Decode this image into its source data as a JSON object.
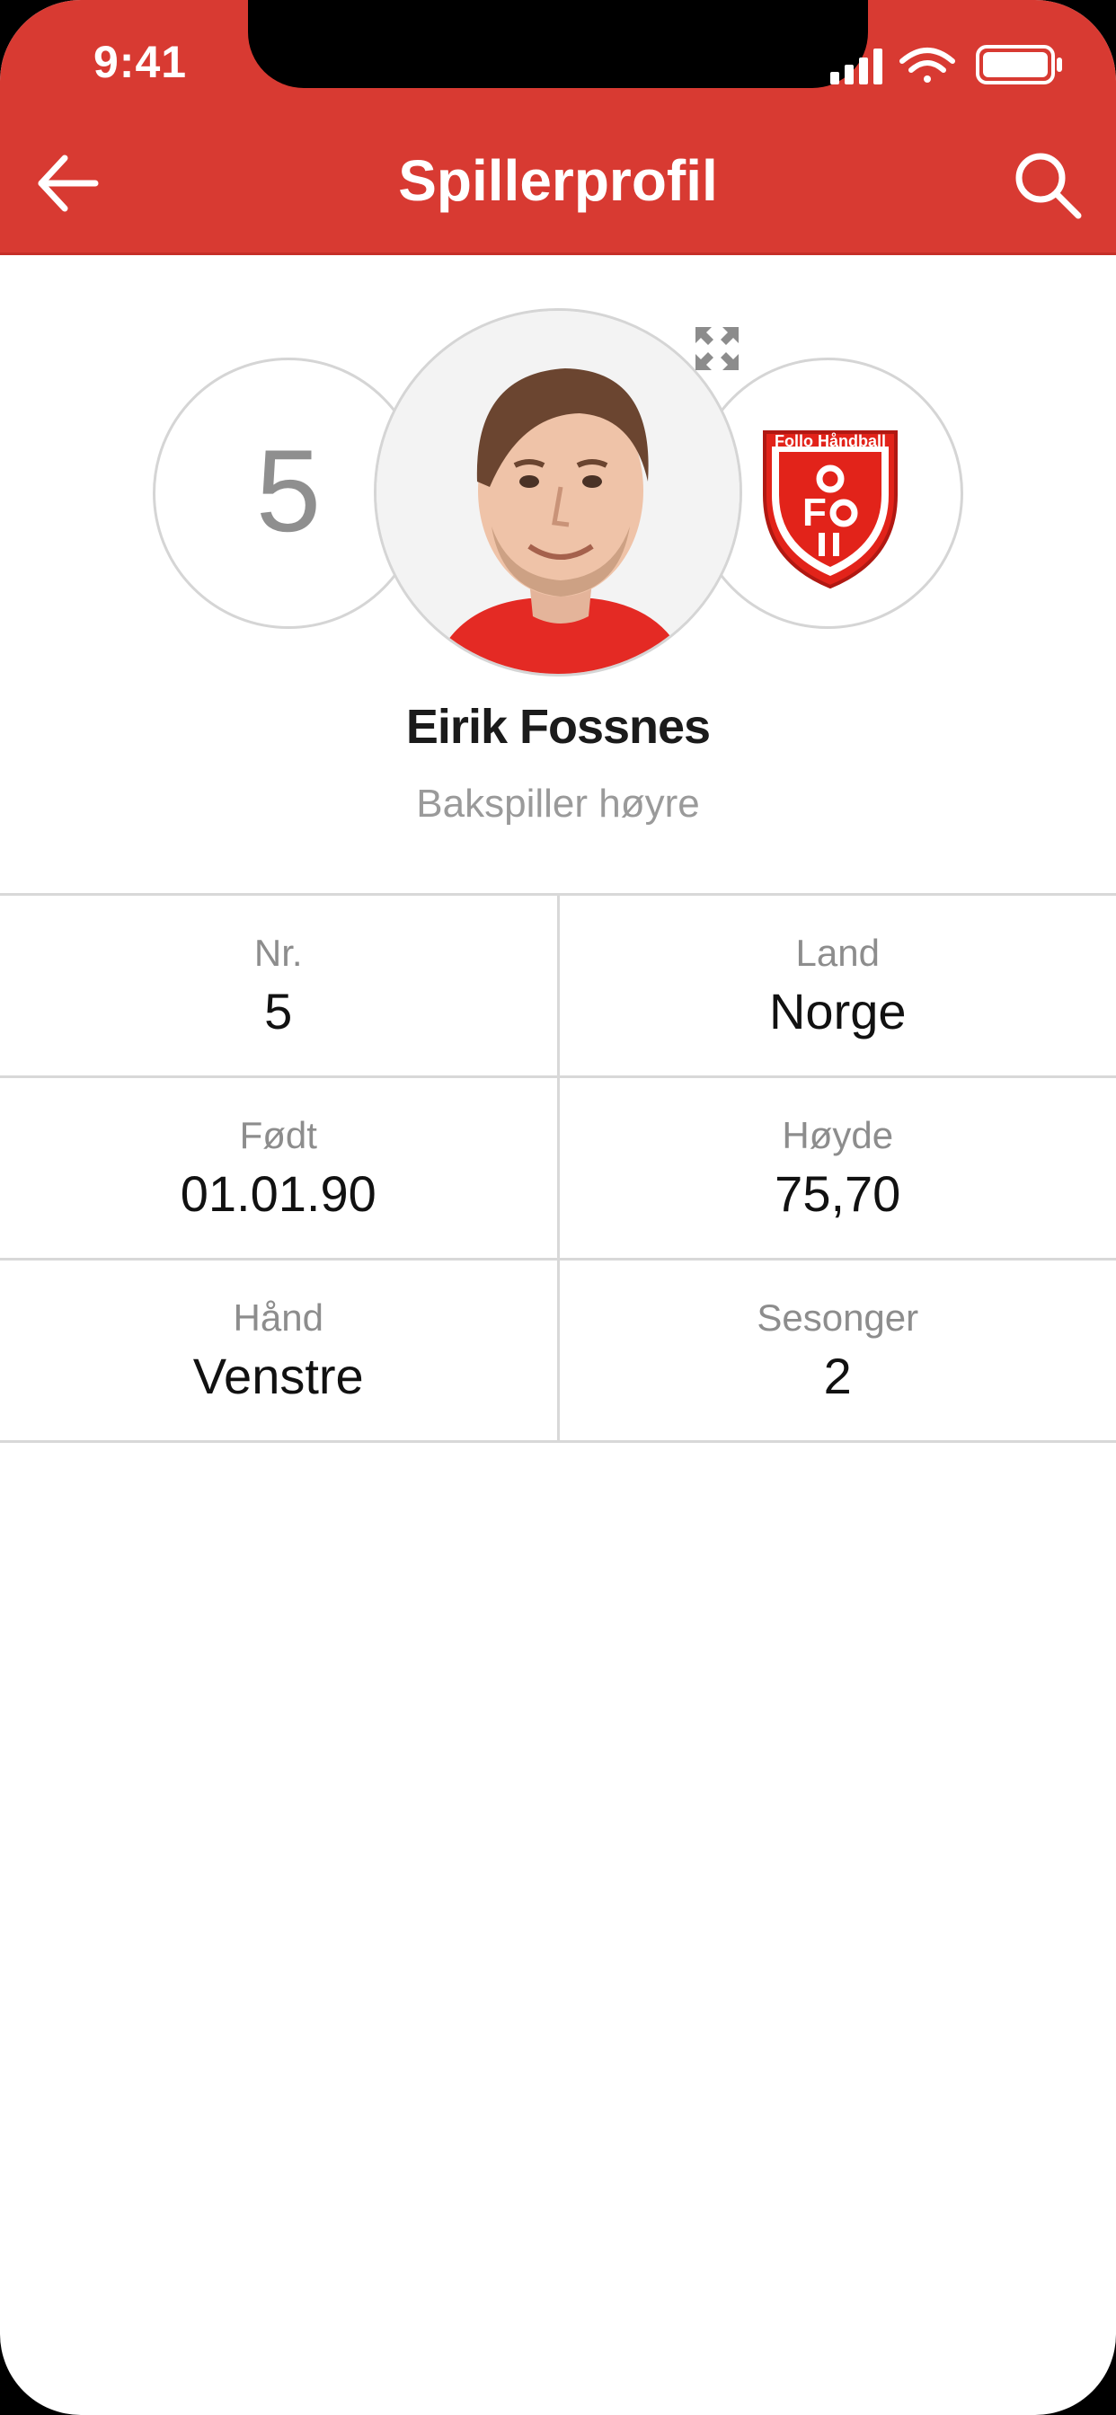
{
  "status_bar": {
    "time": "9:41",
    "icons": [
      "signal-icon",
      "wifi-icon",
      "battery-icon"
    ]
  },
  "header": {
    "title": "Spillerprofil",
    "back_icon": "arrow-left-icon",
    "search_icon": "search-icon",
    "background": "#d83a32"
  },
  "player": {
    "number": "5",
    "name": "Eirik Fossnes",
    "position": "Bakspiller høyre",
    "club_badge": {
      "title": "Follo Håndball",
      "letters": "FOIL"
    }
  },
  "stats": [
    [
      {
        "label": "Nr.",
        "value": "5"
      },
      {
        "label": "Land",
        "value": "Norge"
      }
    ],
    [
      {
        "label": "Født",
        "value": "01.01.90"
      },
      {
        "label": "Høyde",
        "value": "75,70"
      }
    ],
    [
      {
        "label": "Hånd",
        "value": "Venstre"
      },
      {
        "label": "Sesonger",
        "value": "2"
      }
    ]
  ],
  "colors": {
    "accent": "#d83a32",
    "muted_text": "#8d8d8d",
    "divider": "#d8d8d8"
  }
}
